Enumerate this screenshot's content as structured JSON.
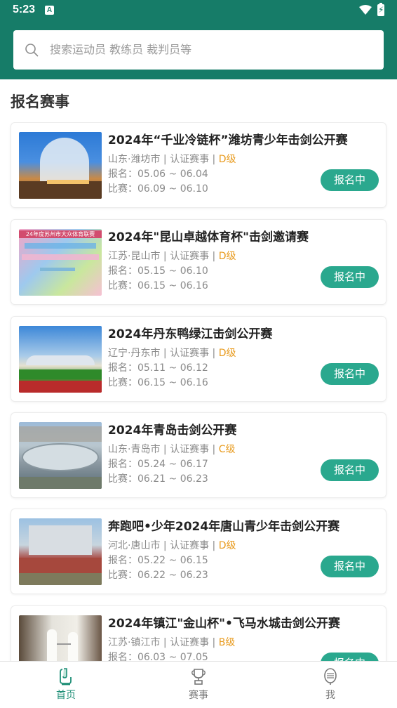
{
  "status_bar": {
    "time": "5:23",
    "notification_letter": "A"
  },
  "search": {
    "placeholder": "搜索运动员 教练员 裁判员等"
  },
  "section_title": "报名赛事",
  "events": [
    {
      "title": "2024年“千业冷链杯”潍坊青少年击剑公开赛",
      "location": "山东·潍坊市",
      "type": "认证赛事",
      "level": "D级",
      "registration": "报名：05.06 ~ 06.04",
      "match": "比赛：06.09 ~ 06.10",
      "button": "报名中",
      "thumb_caption": ""
    },
    {
      "title": "2024年\"昆山卓越体育杯\"击剑邀请赛",
      "location": "江苏·昆山市",
      "type": "认证赛事",
      "level": "D级",
      "registration": "报名：05.15 ~ 06.10",
      "match": "比赛：06.15 ~ 06.16",
      "button": "报名中",
      "thumb_caption": "24年度苏州市大众体育联赛"
    },
    {
      "title": "2024年丹东鸭绿江击剑公开赛",
      "location": "辽宁·丹东市",
      "type": "认证赛事",
      "level": "D级",
      "registration": "报名：05.11 ~ 06.12",
      "match": "比赛：06.15 ~ 06.16",
      "button": "报名中",
      "thumb_caption": ""
    },
    {
      "title": "2024年青岛击剑公开赛",
      "location": "山东·青岛市",
      "type": "认证赛事",
      "level": "C级",
      "registration": "报名：05.24 ~ 06.17",
      "match": "比赛：06.21 ~ 06.23",
      "button": "报名中",
      "thumb_caption": ""
    },
    {
      "title": "奔跑吧•少年2024年唐山青少年击剑公开赛",
      "location": "河北·唐山市",
      "type": "认证赛事",
      "level": "D级",
      "registration": "报名：05.22 ~ 06.15",
      "match": "比赛：06.22 ~ 06.23",
      "button": "报名中",
      "thumb_caption": ""
    },
    {
      "title": "2024年镇江\"金山杯\"•飞马水城击剑公开赛",
      "location": "江苏·镇江市",
      "type": "认证赛事",
      "level": "B级",
      "registration": "报名：06.03 ~ 07.05",
      "match": "",
      "button": "报名中",
      "thumb_caption": ""
    }
  ],
  "bottom_nav": [
    {
      "label": "首页",
      "icon": "home-icon",
      "active": true
    },
    {
      "label": "赛事",
      "icon": "trophy-icon",
      "active": false
    },
    {
      "label": "我",
      "icon": "profile-icon",
      "active": false
    }
  ],
  "colors": {
    "header": "#167c68",
    "button": "#2aa88e",
    "level": "#e89a1c",
    "nav_active": "#1f8f77"
  }
}
